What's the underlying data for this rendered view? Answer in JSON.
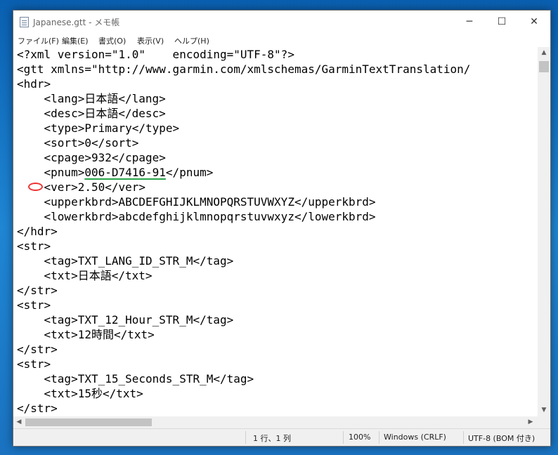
{
  "window": {
    "title": "Japanese.gtt - メモ帳",
    "icon": "notepad-icon",
    "controls": {
      "minimize": "─",
      "maximize": "☐",
      "close": "✕"
    }
  },
  "menu": [
    "ファイル(F)",
    "編集(E)",
    "書式(O)",
    "表示(V)",
    "ヘルプ(H)"
  ],
  "editor": {
    "lines": [
      "<?xml version=\"1.0\"    encoding=\"UTF-8\"?>",
      "<gtt xmlns=\"http://www.garmin.com/xmlschemas/GarminTextTranslation/",
      "<hdr>",
      "    <lang>日本語</lang>",
      "    <desc>日本語</desc>",
      "    <type>Primary</type>",
      "    <sort>0</sort>",
      "    <cpage>932</cpage>",
      "    <pnum>",
      "    <ver>2.50</ver>",
      "    <upperkbrd>ABCDEFGHIJKLMNOPQRSTUVWXYZ</upperkbrd>",
      "    <lowerkbrd>abcdefghijklmnopqrstuvwxyz</lowerkbrd>",
      "</hdr>",
      "<str>",
      "    <tag>TXT_LANG_ID_STR_M</tag>",
      "    <txt>日本語</txt>",
      "</str>",
      "<str>",
      "    <tag>TXT_12_Hour_STR_M</tag>",
      "    <txt>12時間</txt>",
      "</str>",
      "<str>",
      "    <tag>TXT_15_Seconds_STR_M</tag>",
      "    <txt>15秒</txt>",
      "</str>"
    ],
    "pnum_value": "006-D7416-91",
    "pnum_close": "</pnum>",
    "underline_color": "#2aa54a",
    "marker_color": "#ee3333"
  },
  "status": {
    "position": "1 行、1 列",
    "zoom": "100%",
    "line_ending": "Windows (CRLF)",
    "encoding": "UTF-8 (BOM 付き)"
  }
}
